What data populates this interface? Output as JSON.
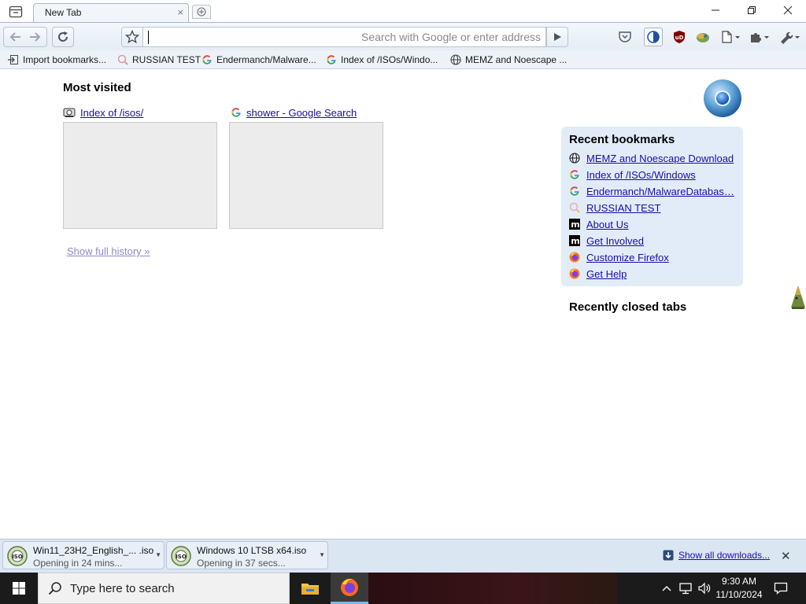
{
  "tab": {
    "title": "New Tab"
  },
  "navbar": {
    "search_placeholder": "Search with Google or enter address"
  },
  "bookmarks_bar": [
    {
      "label": "Import bookmarks...",
      "icon": "import-icon"
    },
    {
      "label": "RUSSIAN TEST",
      "icon": "search-icon"
    },
    {
      "label": "Endermanch/Malware...",
      "icon": "google-icon"
    },
    {
      "label": "Index of /ISOs/Windo...",
      "icon": "google-icon"
    },
    {
      "label": "MEMZ and Noescape ...",
      "icon": "globe-icon"
    }
  ],
  "most_visited": {
    "title": "Most visited",
    "items": [
      {
        "label": "Index of /isos/",
        "icon": "site-icon"
      },
      {
        "label": "shower - Google Search",
        "icon": "google-icon"
      }
    ],
    "history_link": "Show full history »"
  },
  "recent_bookmarks": {
    "title": "Recent bookmarks",
    "items": [
      {
        "label": "MEMZ and Noescape Download",
        "icon": "globe-icon"
      },
      {
        "label": "Index of /ISOs/Windows",
        "icon": "google-icon"
      },
      {
        "label": "Endermanch/MalwareDatabas…",
        "icon": "google-icon"
      },
      {
        "label": "RUSSIAN TEST",
        "icon": "search-icon"
      },
      {
        "label": "About Us",
        "icon": "mozilla-icon"
      },
      {
        "label": "Get Involved",
        "icon": "mozilla-icon"
      },
      {
        "label": "Customize Firefox",
        "icon": "firefox-icon"
      },
      {
        "label": "Get Help",
        "icon": "firefox-icon"
      }
    ]
  },
  "recently_closed": {
    "title": "Recently closed tabs"
  },
  "downloads": {
    "items": [
      {
        "name": "Win11_23H2_English_... .iso",
        "status": "Opening in 24 mins..."
      },
      {
        "name": "Windows 10 LTSB x64.iso",
        "status": "Opening in 37 secs..."
      }
    ],
    "show_all": "Show all downloads..."
  },
  "taskbar": {
    "search_placeholder": "Type here to search",
    "time": "9:30 AM",
    "date": "11/10/2024"
  },
  "colors": {
    "link": "#1a0dab",
    "panel": "#e2ecf8",
    "taskbar": "#1b1b1b"
  }
}
